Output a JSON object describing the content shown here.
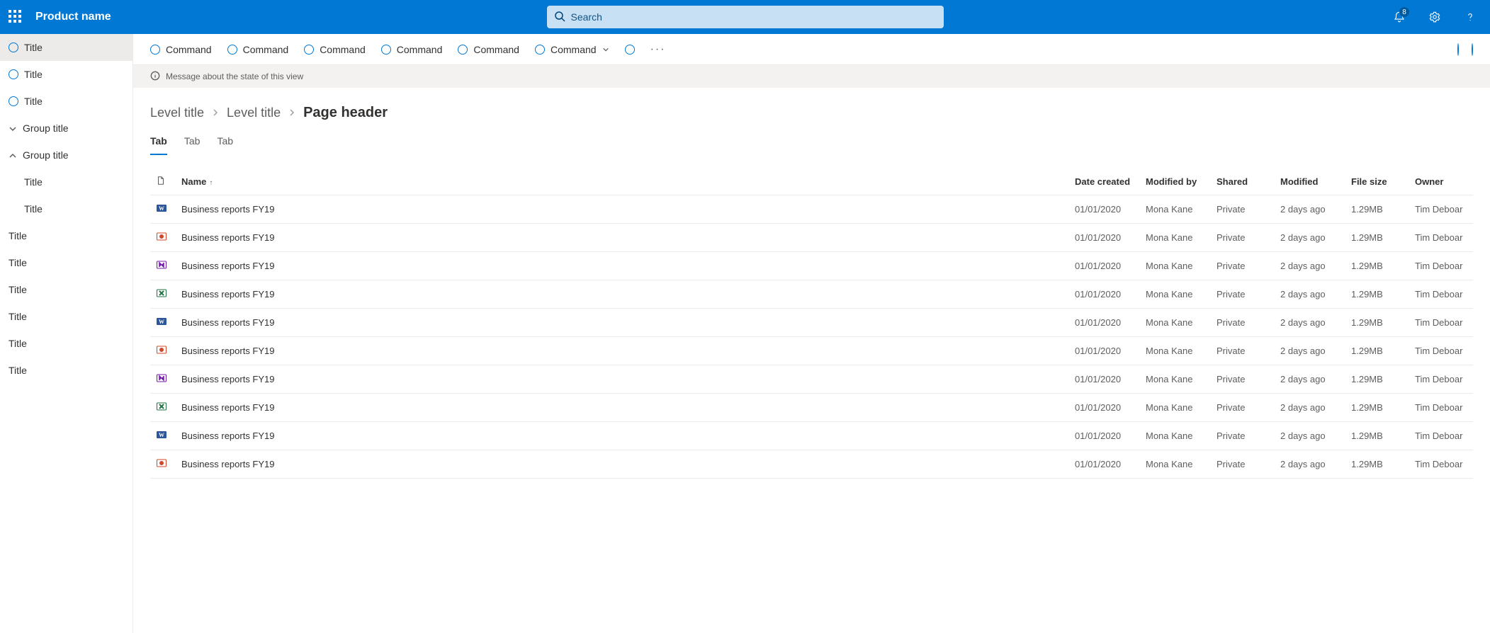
{
  "header": {
    "product_name": "Product name",
    "search_placeholder": "Search",
    "notification_count": "8"
  },
  "left_nav": {
    "top_items": [
      {
        "label": "Title",
        "selected": true
      },
      {
        "label": "Title",
        "selected": false
      },
      {
        "label": "Title",
        "selected": false
      }
    ],
    "groups": [
      {
        "label": "Group title",
        "expanded": false,
        "children": []
      },
      {
        "label": "Group title",
        "expanded": true,
        "children": [
          {
            "label": "Title"
          },
          {
            "label": "Title"
          }
        ]
      }
    ],
    "flat_items": [
      {
        "label": "Title"
      },
      {
        "label": "Title"
      },
      {
        "label": "Title"
      },
      {
        "label": "Title"
      },
      {
        "label": "Title"
      },
      {
        "label": "Title"
      }
    ]
  },
  "command_bar": {
    "commands": [
      {
        "label": "Command",
        "has_chevron": false
      },
      {
        "label": "Command",
        "has_chevron": false
      },
      {
        "label": "Command",
        "has_chevron": false
      },
      {
        "label": "Command",
        "has_chevron": false
      },
      {
        "label": "Command",
        "has_chevron": false
      },
      {
        "label": "Command",
        "has_chevron": true
      }
    ]
  },
  "message_bar": {
    "text": "Message about the state of this view"
  },
  "breadcrumb": {
    "crumbs": [
      "Level title",
      "Level title"
    ],
    "page_header": "Page header"
  },
  "tabs": [
    {
      "label": "Tab",
      "active": true
    },
    {
      "label": "Tab",
      "active": false
    },
    {
      "label": "Tab",
      "active": false
    }
  ],
  "table": {
    "columns": [
      {
        "key": "name",
        "label": "Name",
        "sorted": "asc"
      },
      {
        "key": "date_created",
        "label": "Date created"
      },
      {
        "key": "modified_by",
        "label": "Modified by"
      },
      {
        "key": "shared",
        "label": "Shared"
      },
      {
        "key": "modified",
        "label": "Modified"
      },
      {
        "key": "file_size",
        "label": "File size"
      },
      {
        "key": "owner",
        "label": "Owner"
      }
    ],
    "rows": [
      {
        "icon": "word",
        "name": "Business reports FY19",
        "date_created": "01/01/2020",
        "modified_by": "Mona Kane",
        "shared": "Private",
        "modified": "2 days ago",
        "file_size": "1.29MB",
        "owner": "Tim Deboar"
      },
      {
        "icon": "ppt",
        "name": "Business reports FY19",
        "date_created": "01/01/2020",
        "modified_by": "Mona Kane",
        "shared": "Private",
        "modified": "2 days ago",
        "file_size": "1.29MB",
        "owner": "Tim Deboar"
      },
      {
        "icon": "onenote",
        "name": "Business reports FY19",
        "date_created": "01/01/2020",
        "modified_by": "Mona Kane",
        "shared": "Private",
        "modified": "2 days ago",
        "file_size": "1.29MB",
        "owner": "Tim Deboar"
      },
      {
        "icon": "excel",
        "name": "Business reports FY19",
        "date_created": "01/01/2020",
        "modified_by": "Mona Kane",
        "shared": "Private",
        "modified": "2 days ago",
        "file_size": "1.29MB",
        "owner": "Tim Deboar"
      },
      {
        "icon": "word",
        "name": "Business reports FY19",
        "date_created": "01/01/2020",
        "modified_by": "Mona Kane",
        "shared": "Private",
        "modified": "2 days ago",
        "file_size": "1.29MB",
        "owner": "Tim Deboar"
      },
      {
        "icon": "ppt",
        "name": "Business reports FY19",
        "date_created": "01/01/2020",
        "modified_by": "Mona Kane",
        "shared": "Private",
        "modified": "2 days ago",
        "file_size": "1.29MB",
        "owner": "Tim Deboar"
      },
      {
        "icon": "onenote",
        "name": "Business reports FY19",
        "date_created": "01/01/2020",
        "modified_by": "Mona Kane",
        "shared": "Private",
        "modified": "2 days ago",
        "file_size": "1.29MB",
        "owner": "Tim Deboar"
      },
      {
        "icon": "excel",
        "name": "Business reports FY19",
        "date_created": "01/01/2020",
        "modified_by": "Mona Kane",
        "shared": "Private",
        "modified": "2 days ago",
        "file_size": "1.29MB",
        "owner": "Tim Deboar"
      },
      {
        "icon": "word",
        "name": "Business reports FY19",
        "date_created": "01/01/2020",
        "modified_by": "Mona Kane",
        "shared": "Private",
        "modified": "2 days ago",
        "file_size": "1.29MB",
        "owner": "Tim Deboar"
      },
      {
        "icon": "ppt",
        "name": "Business reports FY19",
        "date_created": "01/01/2020",
        "modified_by": "Mona Kane",
        "shared": "Private",
        "modified": "2 days ago",
        "file_size": "1.29MB",
        "owner": "Tim Deboar"
      }
    ]
  }
}
